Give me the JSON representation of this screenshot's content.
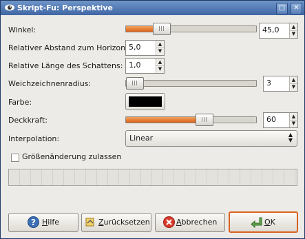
{
  "window": {
    "title": "Skript-Fu: Perspektive",
    "close_glyph": "✕",
    "maximize_glyph": "□"
  },
  "fields": {
    "winkel": {
      "label": "Winkel:",
      "value": "45,0",
      "slider_fraction": 0.27
    },
    "abstand": {
      "label": "Relativer Abstand zum Horizont:",
      "value": "5,0"
    },
    "laenge": {
      "label": "Relative Länge des Schattens:",
      "value": "1,0"
    },
    "weichzeichnen": {
      "label": "Weichzeichnenradius:",
      "value": "3",
      "slider_fraction": 0.03
    },
    "farbe": {
      "label": "Farbe:",
      "color": "#000000"
    },
    "deckkraft": {
      "label": "Deckkraft:",
      "value": "60",
      "slider_fraction": 0.6
    },
    "interpolation": {
      "label": "Interpolation:",
      "value": "Linear"
    },
    "resize": {
      "label": "Größenänderung zulassen",
      "checked": false
    }
  },
  "buttons": {
    "help": {
      "label_prefix": "",
      "label_mnemonic": "H",
      "label_rest": "ilfe"
    },
    "reset": {
      "label_prefix": "",
      "label_mnemonic": "Z",
      "label_rest": "urücksetzen"
    },
    "cancel": {
      "label_prefix": "",
      "label_mnemonic": "A",
      "label_rest": "bbrechen"
    },
    "ok": {
      "label_prefix": "",
      "label_mnemonic": "O",
      "label_rest": "K"
    }
  },
  "colors": {
    "accent_orange": "#d8621e",
    "titlebar_blue": "#3f66a3",
    "dialog_bg": "#edebe7"
  },
  "icons": {
    "title": "gimp-eye-icon",
    "help": "help-question-icon",
    "reset": "reset-icon",
    "cancel": "cancel-x-icon",
    "ok": "ok-arrow-icon"
  }
}
